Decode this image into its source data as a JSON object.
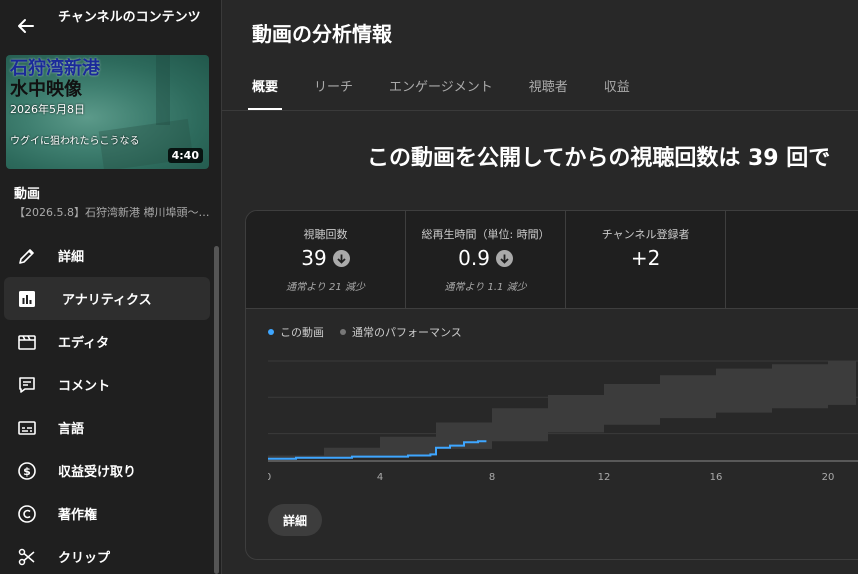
{
  "sidebar": {
    "title": "チャンネルのコンテンツ",
    "thumbnail": {
      "line1": "石狩湾新港",
      "line2": "水中映像",
      "date": "2026年5月8日",
      "caption": "ウグイに狙われたらこうなる",
      "duration": "4:40"
    },
    "video_label": "動画",
    "video_title": "【2026.5.8】石狩湾新港 樽川埠頭〜…",
    "items": [
      {
        "label": "詳細",
        "icon": "pencil-icon"
      },
      {
        "label": "アナリティクス",
        "icon": "analytics-icon"
      },
      {
        "label": "エディタ",
        "icon": "editor-icon"
      },
      {
        "label": "コメント",
        "icon": "comment-icon"
      },
      {
        "label": "言語",
        "icon": "subtitles-icon"
      },
      {
        "label": "収益受け取り",
        "icon": "dollar-icon"
      },
      {
        "label": "著作権",
        "icon": "copyright-icon"
      },
      {
        "label": "クリップ",
        "icon": "scissors-icon"
      }
    ]
  },
  "main": {
    "title": "動画の分析情報",
    "tabs": [
      {
        "label": "概要"
      },
      {
        "label": "リーチ"
      },
      {
        "label": "エンゲージメント"
      },
      {
        "label": "視聴者"
      },
      {
        "label": "収益"
      }
    ],
    "headline": "この動画を公開してからの視聴回数は 39 回で",
    "metrics": [
      {
        "label": "視聴回数",
        "value": "39",
        "sub": "通常より 21 減少"
      },
      {
        "label": "総再生時間（単位: 時間）",
        "value": "0.9",
        "sub": "通常より 1.1 減少"
      },
      {
        "label": "チャンネル登録者",
        "value": "+2",
        "sub": ""
      }
    ],
    "details_button": "詳細"
  },
  "colors": {
    "this_video": "#3ea6ff",
    "typical": "#777777"
  },
  "chart_data": {
    "type": "area",
    "legend": [
      "この動画",
      "通常のパフォーマンス"
    ],
    "x_ticks": [
      "0",
      "4",
      "8",
      "12",
      "16",
      "20"
    ],
    "xlim": [
      0,
      21
    ],
    "ylim": [
      0,
      100
    ],
    "series": [
      {
        "name": "この動画",
        "x": [
          0,
          1,
          2,
          3,
          4,
          5,
          5.8,
          6,
          6.5,
          7,
          7.5,
          7.8
        ],
        "values": [
          2,
          3,
          3,
          4,
          4,
          5,
          6,
          12,
          14,
          17,
          18,
          18
        ]
      },
      {
        "name": "通常のパフォーマンス",
        "x": [
          0,
          2,
          4,
          6,
          8,
          10,
          12,
          14,
          16,
          18,
          20,
          21
        ],
        "lower": [
          2,
          3,
          5,
          11,
          18,
          26,
          33,
          39,
          44,
          48,
          51,
          52
        ],
        "upper": [
          5,
          12,
          22,
          35,
          48,
          60,
          70,
          78,
          84,
          88,
          91,
          92
        ]
      }
    ]
  }
}
